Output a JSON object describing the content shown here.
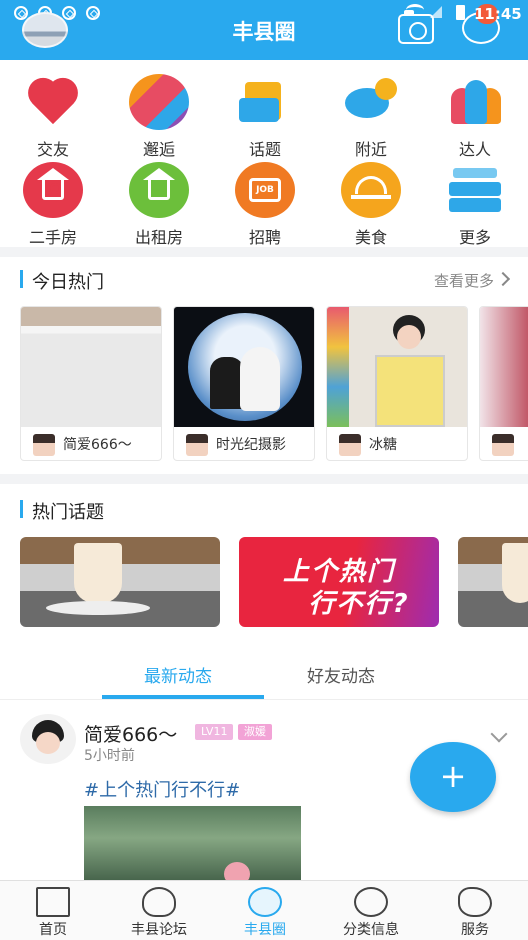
{
  "status_bar": {
    "time": "11:45"
  },
  "header": {
    "title": "丰县圈"
  },
  "categories": [
    {
      "label": "交友",
      "icon": "hearts-icon"
    },
    {
      "label": "邂逅",
      "icon": "love-icon"
    },
    {
      "label": "话题",
      "icon": "topic-icon"
    },
    {
      "label": "附近",
      "icon": "nearby-icon"
    },
    {
      "label": "达人",
      "icon": "people-icon"
    },
    {
      "label": "二手房",
      "icon": "house-icon",
      "color": "#e5394b"
    },
    {
      "label": "出租房",
      "icon": "house-icon",
      "color": "#6cbf3b"
    },
    {
      "label": "招聘",
      "icon": "job-bag-icon",
      "color": "#f07a23"
    },
    {
      "label": "美食",
      "icon": "food-cover-icon",
      "color": "#f5a51d"
    },
    {
      "label": "更多",
      "icon": "more-stack-icon"
    }
  ],
  "job_icon_text": "JOB",
  "today_hot": {
    "title": "今日热门",
    "see_more": "查看更多",
    "cards": [
      {
        "author": "简爱666～"
      },
      {
        "author": "时光纪摄影"
      },
      {
        "author": "冰糖"
      }
    ]
  },
  "hot_topics": {
    "title": "热门话题",
    "banner_text": [
      "上个热门",
      "行不行?"
    ]
  },
  "feed_tabs": [
    {
      "label": "最新动态",
      "active": true
    },
    {
      "label": "好友动态",
      "active": false
    }
  ],
  "post": {
    "author": "简爱666～",
    "level": "LV11",
    "tag": "淑媛",
    "time": "5小时前",
    "hashtag": "#上个热门行不行#"
  },
  "fab_label": "+",
  "bottom_nav": [
    {
      "label": "首页",
      "active": false
    },
    {
      "label": "丰县论坛",
      "active": false
    },
    {
      "label": "丰县圈",
      "active": true
    },
    {
      "label": "分类信息",
      "active": false
    },
    {
      "label": "服务",
      "active": false
    }
  ],
  "colors": {
    "primary": "#29a9ee",
    "badge": "#f25a3a"
  }
}
